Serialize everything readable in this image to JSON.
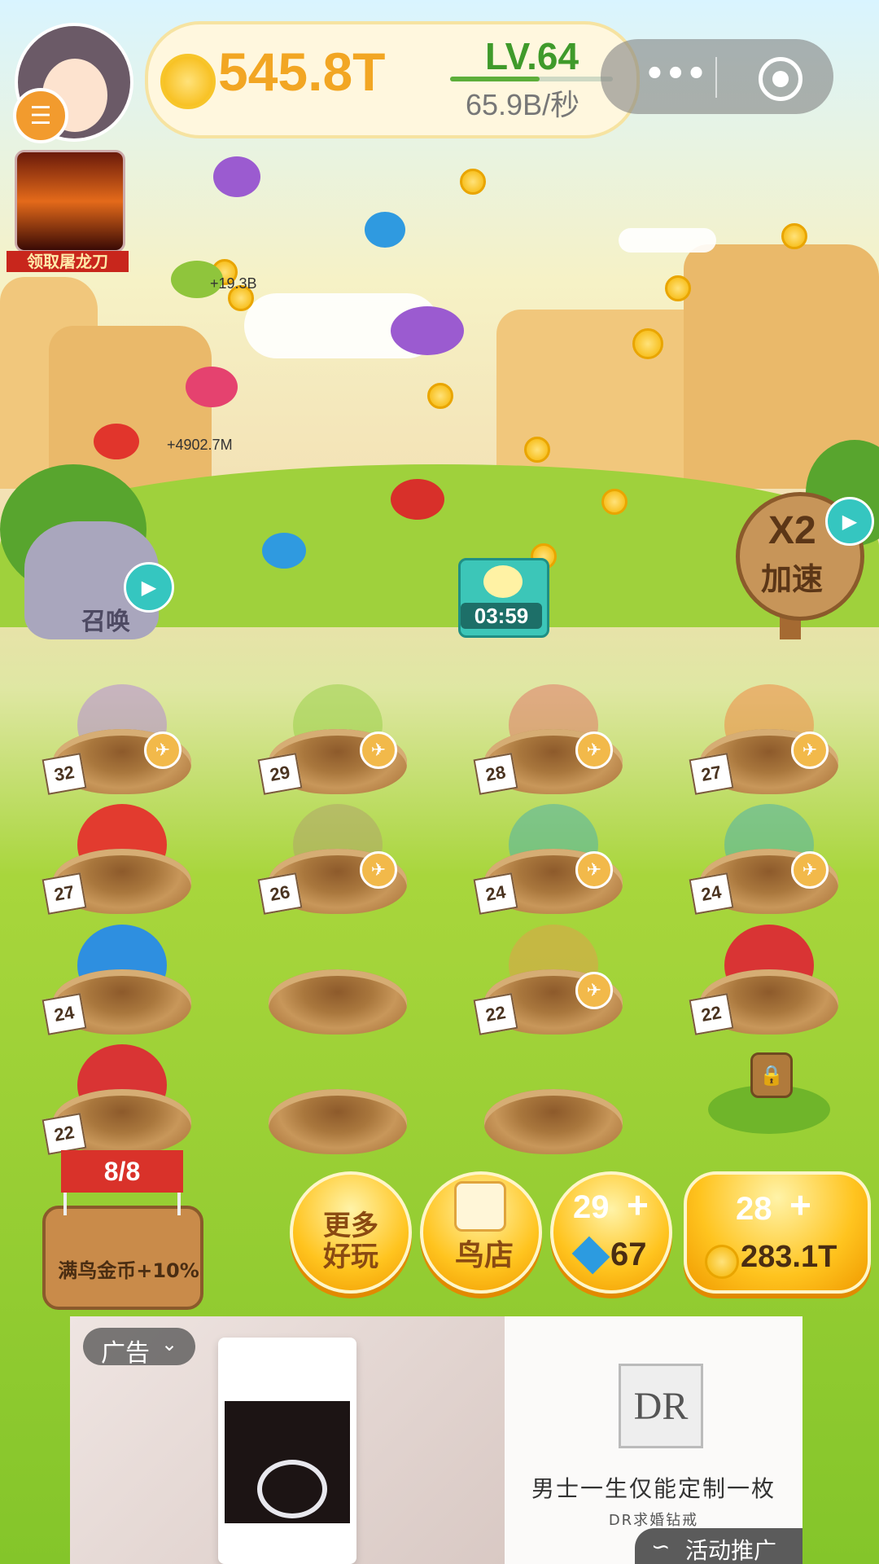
{
  "hud": {
    "coins": "545.8T",
    "level": "LV.64",
    "rate": "65.9B/秒",
    "more_icon": "more-dots-icon",
    "close_icon": "target-close-icon"
  },
  "promo_badge": {
    "label": "领取屠龙刀"
  },
  "floating_texts": [
    "+19.3B",
    "+4902.7M"
  ],
  "summon": {
    "label": "召唤",
    "video_icon": "tv-video-icon"
  },
  "chest": {
    "timer": "03:59"
  },
  "speed_boost": {
    "title": "X2",
    "subtitle": "加速",
    "video_icon": "tv-video-icon"
  },
  "nests": [
    {
      "level": "32",
      "fly": true,
      "bird_color": "#b58bd6"
    },
    {
      "level": "29",
      "fly": true,
      "bird_color": "#9bcf4a"
    },
    {
      "level": "28",
      "fly": true,
      "bird_color": "#e07a6a"
    },
    {
      "level": "27",
      "fly": true,
      "bird_color": "#ef8a45"
    },
    {
      "level": "27",
      "fly": false,
      "bird_color": "#e23b2f"
    },
    {
      "level": "26",
      "fly": true,
      "bird_color": "#b0a46a"
    },
    {
      "level": "24",
      "fly": true,
      "bird_color": "#4fb2a9"
    },
    {
      "level": "24",
      "fly": true,
      "bird_color": "#4fb2a9"
    },
    {
      "level": "24",
      "fly": false,
      "bird_color": "#2e8fe0"
    },
    {
      "level": "",
      "fly": false,
      "bird_color": ""
    },
    {
      "level": "22",
      "fly": true,
      "bird_color": "#e0a04a"
    },
    {
      "level": "22",
      "fly": false,
      "bird_color": "#d93434"
    },
    {
      "level": "22",
      "fly": false,
      "bird_color": "#d93434"
    },
    {
      "level": "",
      "fly": false,
      "bird_color": ""
    },
    {
      "level": "",
      "fly": false,
      "bird_color": ""
    },
    {
      "level": "locked",
      "fly": false,
      "bird_color": ""
    }
  ],
  "stump": {
    "flag": "8/8",
    "label": "满鸟金币+10%"
  },
  "buttons": {
    "more_games": "更多\n好玩",
    "bird_shop": "鸟店",
    "gem_buy": {
      "level": "29",
      "plus": "+",
      "price": "67"
    },
    "coin_buy": {
      "level": "28",
      "plus": "+",
      "price": "283.1T"
    }
  },
  "ad": {
    "tag": "广告",
    "logo": "DR",
    "headline": "男士一生仅能定制一枚",
    "subline": "DR求婚钻戒",
    "promo": "活动推广"
  },
  "colors": {
    "coin_text": "#f2a623",
    "level_text": "#3f9a2a",
    "accent": "#ffc41f"
  }
}
